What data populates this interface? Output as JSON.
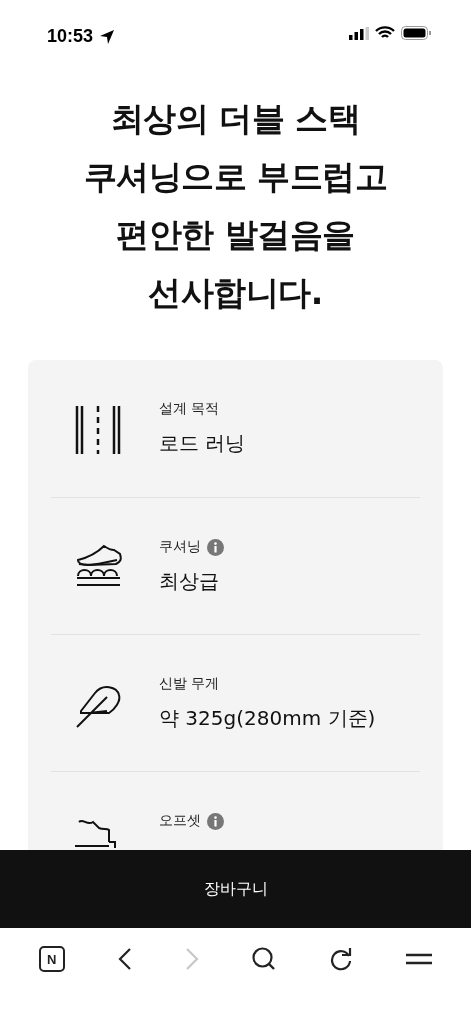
{
  "status_bar": {
    "time": "10:53"
  },
  "headline": [
    "최상의 더블 스택",
    "쿠셔닝으로 부드럽고",
    "편안한 발걸음을",
    "선사합니다."
  ],
  "specs": [
    {
      "kind": "road",
      "label": "설계 목적",
      "info": false,
      "value": "로드 러닝"
    },
    {
      "kind": "shoe",
      "label": "쿠셔닝",
      "info": true,
      "value": "최상급"
    },
    {
      "kind": "feather",
      "label": "신발 무게",
      "info": false,
      "value": "약 325g(280mm 기준)"
    },
    {
      "kind": "offset",
      "label": "오프셋",
      "info": true
    }
  ],
  "cart_button": "장바구니",
  "browser_bar": {
    "logo": "N",
    "back": {
      "disabled": false
    },
    "forward": {
      "disabled": true
    }
  }
}
